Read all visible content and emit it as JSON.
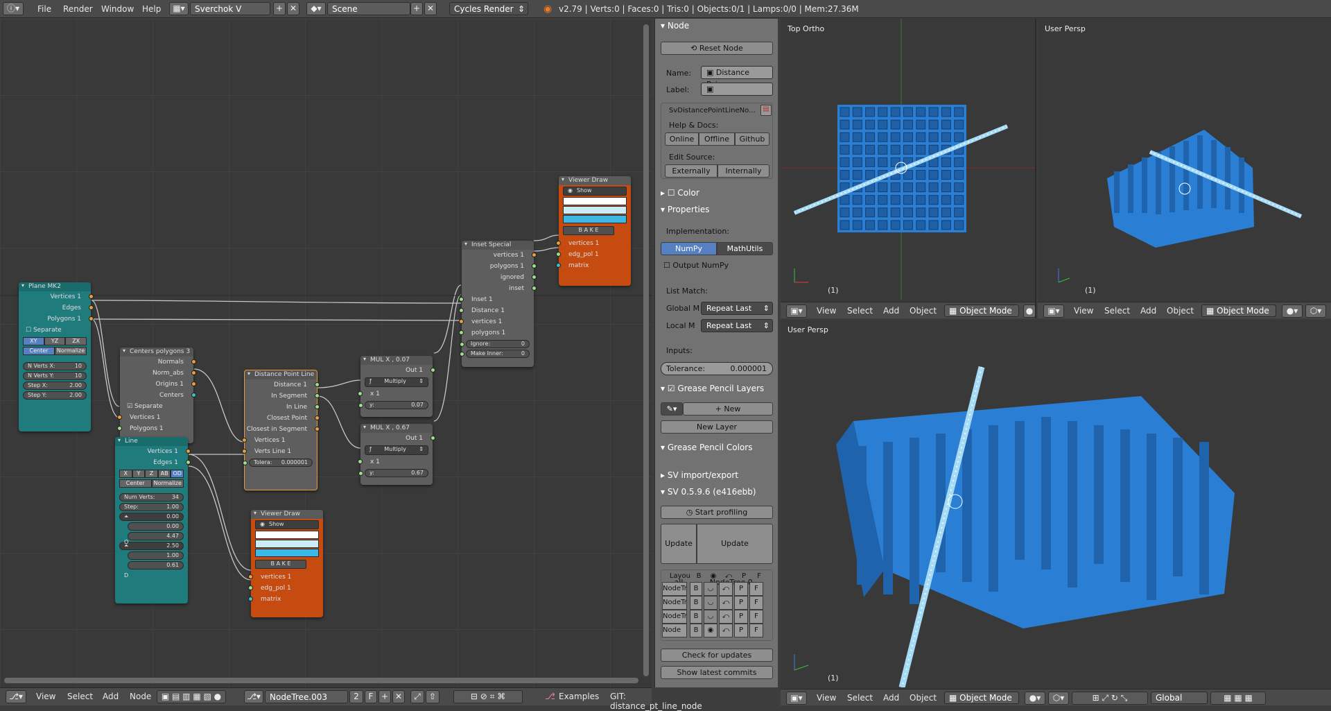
{
  "topbar": {
    "menus": [
      "File",
      "Render",
      "Window",
      "Help"
    ],
    "screen_layout": "Sverchok V",
    "scene": "Scene",
    "render_engine": "Cycles Render",
    "stats": "v2.79 | Verts:0 | Faces:0 | Tris:0 | Objects:0/1 | Lamps:0/0 | Mem:27.36M"
  },
  "nodes": {
    "plane": {
      "title": "Plane MK2",
      "outputs": [
        "Vertices 1",
        "Edges",
        "Polygons 1"
      ],
      "separate": "Separate",
      "planes": [
        "XY",
        "YZ",
        "ZX"
      ],
      "center": "Center",
      "normalize": "Normalize",
      "fields": [
        {
          "k": "N Verts X:",
          "v": "10"
        },
        {
          "k": "N Verts Y:",
          "v": "10"
        },
        {
          "k": "Step X:",
          "v": "2.00"
        },
        {
          "k": "Step Y:",
          "v": "2.00"
        }
      ]
    },
    "centers": {
      "title": "Centers polygons 3",
      "outputs": [
        "Normals",
        "Norm_abs",
        "Origins 1",
        "Centers"
      ],
      "separate": "Separate",
      "inputs": [
        "Vertices 1",
        "Polygons 1"
      ]
    },
    "line": {
      "title": "Line",
      "outputs": [
        "Vertices 1",
        "Edges 1"
      ],
      "axes": [
        "X",
        "Y",
        "Z",
        "AB",
        "OD"
      ],
      "center": "Center",
      "normalize": "Normalize",
      "fields": [
        {
          "k": "Num Verts:",
          "v": "34"
        },
        {
          "k": "Step:",
          "v": "1.00"
        },
        {
          "k": "",
          "v": "0.00"
        },
        {
          "k": "",
          "v": "0.00"
        },
        {
          "k": "",
          "v": "4.47"
        },
        {
          "k": "",
          "v": "2.50"
        },
        {
          "k": "",
          "v": "1.00"
        },
        {
          "k": "",
          "v": "0.61"
        }
      ],
      "letters": [
        "O",
        "D"
      ]
    },
    "distance": {
      "title": "Distance Point Line",
      "outputs": [
        "Distance 1",
        "In Segment",
        "In Line",
        "Closest Point",
        "Closest in Segment"
      ],
      "inputs": [
        "Vertices 1",
        "Verts Line 1"
      ],
      "tol_label": "Tolera:",
      "tol_value": "0.000001"
    },
    "mul1": {
      "title": "MUL X , 0.07",
      "out": "Out 1",
      "op": "Multiply",
      "x": "x 1",
      "y_label": "y:",
      "y": "0.07"
    },
    "mul2": {
      "title": "MUL X , 0.67",
      "out": "Out 1",
      "op": "Multiply",
      "x": "x 1",
      "y_label": "y:",
      "y": "0.67"
    },
    "inset": {
      "title": "Inset Special",
      "outputs": [
        "vertices 1",
        "polygons 1",
        "ignored",
        "inset"
      ],
      "inputs": [
        "Inset 1",
        "Distance 1",
        "vertices 1",
        "polygons 1"
      ],
      "ignore_label": "Ignore:",
      "ignore": "0",
      "inner_label": "Make Inner:",
      "inner": "0"
    },
    "viewer1": {
      "title": "Viewer Draw",
      "show": "Show",
      "bake": "B A K E",
      "inputs": [
        "vertices 1",
        "edg_pol 1",
        "matrix"
      ]
    },
    "viewer2": {
      "title": "Viewer Draw",
      "show": "Show",
      "bake": "B A K E",
      "inputs": [
        "vertices 1",
        "edg_pol 1",
        "matrix"
      ]
    }
  },
  "props": {
    "node_header": "Node",
    "reset": "Reset Node",
    "name_label": "Name:",
    "name": "Distance Poin...",
    "label_label": "Label:",
    "bl_idname": "SvDistancePointLineNo...",
    "help": "Help & Docs:",
    "help_btns": [
      "Online",
      "Offline",
      "Github"
    ],
    "edit_source": "Edit Source:",
    "edit_btns": [
      "Externally",
      "Internally"
    ],
    "color": "Color",
    "properties": "Properties",
    "impl_label": "Implementation:",
    "impl": [
      "NumPy",
      "MathUtils"
    ],
    "output_numpy": "Output NumPy",
    "list_match": "List Match:",
    "global_label": "Global M",
    "global_val": "Repeat Last",
    "local_label": "Local M",
    "local_val": "Repeat Last",
    "inputs": "Inputs:",
    "tol_label": "Tolerance:",
    "tol_val": "0.000001",
    "gp_layers": "Grease Pencil Layers",
    "new": "New",
    "new_layer": "New Layer",
    "gp_colors": "Grease Pencil Colors",
    "sv_import": "SV import/export",
    "sv_version": "SV 0.5.9.6 (e416ebb)",
    "start_profiling": "Start profiling",
    "update_all": "Update all",
    "update_tree": "Update NodeTree.0...",
    "table_head": [
      "Layou",
      "B",
      "",
      "",
      "P",
      "F"
    ],
    "table_rows": [
      "NodeTr",
      "NodeTr",
      "NodeTr",
      "Node"
    ],
    "b": "B",
    "p": "P",
    "f": "F",
    "check_updates": "Check for updates",
    "show_commits": "Show latest commits"
  },
  "viewports": {
    "top": {
      "title": "Top Ortho",
      "counter": "(1)"
    },
    "persp_small": {
      "title": "User Persp",
      "counter": "(1)"
    },
    "persp_big": {
      "title": "User Persp",
      "counter": "(1)"
    },
    "menus": [
      "View",
      "Select",
      "Add",
      "Object"
    ],
    "mode": "Object Mode",
    "orientation": "Global"
  },
  "nodebar": {
    "menus": [
      "View",
      "Select",
      "Add",
      "Node"
    ],
    "tree": "NodeTree.003",
    "users": "2",
    "fake": "F",
    "examples": "Examples",
    "git": "GIT: distance_pt_line_node"
  },
  "colors": {
    "socket_yellow": "#e8a13a",
    "socket_green": "#9be08a",
    "socket_teal": "#3ac0c7",
    "accent_blue": "#5680c2",
    "mesh_blue": "#2a7fd4"
  }
}
